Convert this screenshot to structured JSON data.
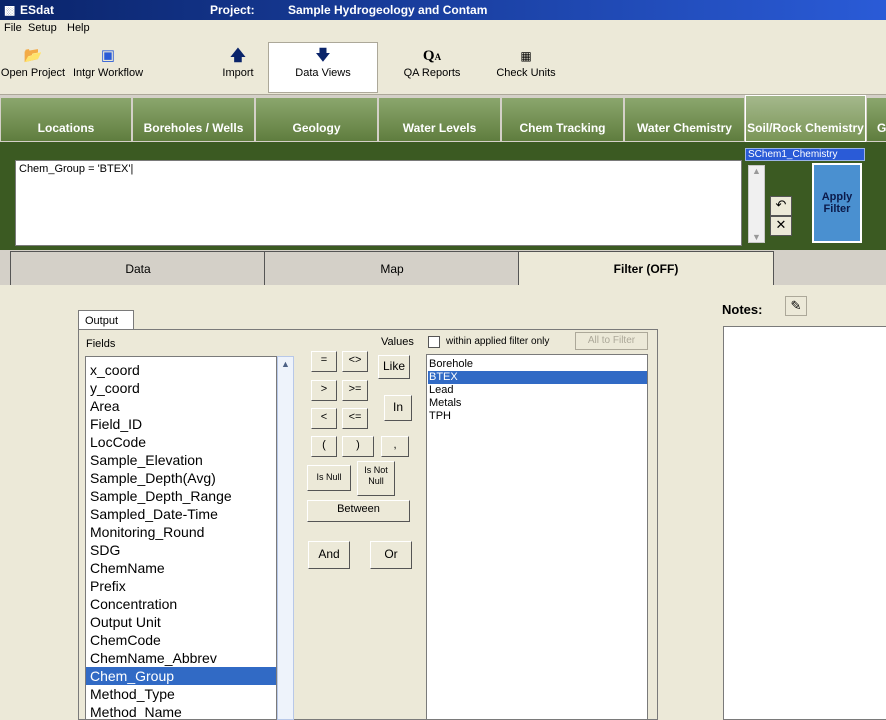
{
  "window": {
    "app_title": "ESdat",
    "project_label": "Project:",
    "project_name": "Sample Hydrogeology and Contam"
  },
  "menu": [
    "File",
    "Setup",
    "Help"
  ],
  "toolbar": [
    {
      "label": "Open Project",
      "icon": "folder-open-icon"
    },
    {
      "label": "Intgr Workflow",
      "icon": "workflow-icon"
    },
    {
      "label": "Import",
      "icon": "arrow-up-icon"
    },
    {
      "label": "Data Views",
      "icon": "arrow-down-icon",
      "active": true
    },
    {
      "label": "QA Reports",
      "icon": "qa-icon"
    },
    {
      "label": "Check Units",
      "icon": "units-icon"
    }
  ],
  "data_view_tabs": [
    "Locations",
    "Boreholes / Wells",
    "Geology",
    "Water Levels",
    "Chem Tracking",
    "Water Chemistry",
    "Soil/Rock Chemistry",
    "G"
  ],
  "filter": {
    "datasource": "SChem1_Chemistry",
    "expression": "Chem_Group =  'BTEX'|",
    "apply_label": "Apply Filter"
  },
  "lower_tabs": [
    "Data",
    "Map",
    "Filter (OFF)"
  ],
  "output_tab": "Output",
  "fields_label": "Fields",
  "fields": [
    "x_coord",
    "y_coord",
    "Area",
    "Field_ID",
    "LocCode",
    "Sample_Elevation",
    "Sample_Depth(Avg)",
    "Sample_Depth_Range",
    "Sampled_Date-Time",
    "Monitoring_Round",
    "SDG",
    "ChemName",
    "Prefix",
    "Concentration",
    "Output Unit",
    "ChemCode",
    "ChemName_Abbrev",
    "Chem_Group",
    "Method_Type",
    "Method_Name"
  ],
  "selected_field": "Chem_Group",
  "operators": {
    "eq": "=",
    "ne": "<>",
    "like": "Like",
    "gt": ">",
    "ge": ">=",
    "in": "In",
    "lt": "<",
    "le": "<=",
    "lparen": "(",
    "rparen": ")",
    "comma": ",",
    "isnull": "Is Null",
    "isnotnull": "Is Not Null",
    "between": "Between",
    "and": "And",
    "or": "Or"
  },
  "values_label": "Values",
  "within_filter_label": "within applied filter only",
  "all_to_filter_label": "All to Filter",
  "values": [
    "Borehole",
    "BTEX",
    "Lead",
    "Metals",
    "TPH"
  ],
  "selected_value": "BTEX",
  "notes_label": "Notes:"
}
